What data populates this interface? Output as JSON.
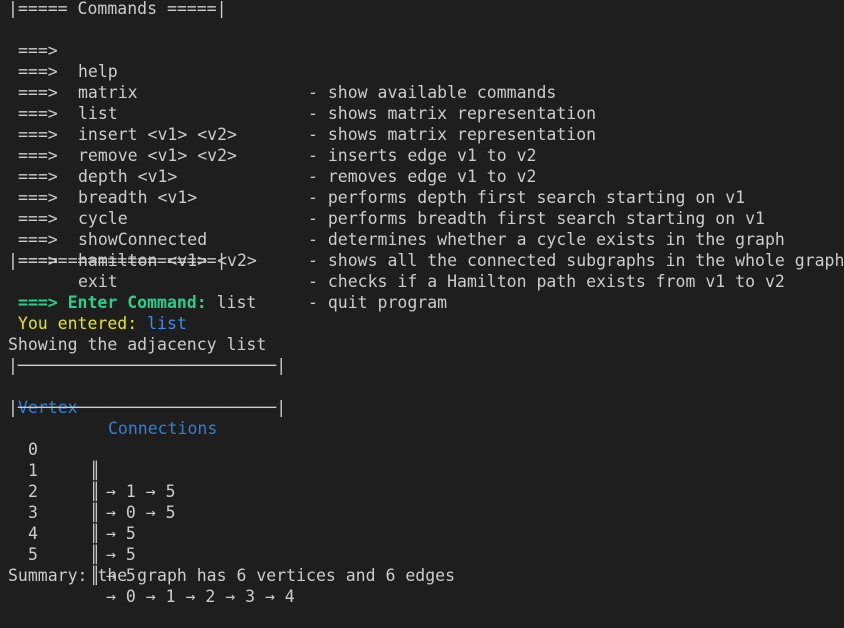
{
  "menu": {
    "top_border": "|===== Commands =====|",
    "bottom_border": "|====================|",
    "arrow": "===>",
    "commands": [
      {
        "name": "help",
        "desc": "- show available commands"
      },
      {
        "name": "matrix",
        "desc": "- shows matrix representation"
      },
      {
        "name": "list",
        "desc": "- shows matrix representation"
      },
      {
        "name": "insert <v1> <v2>",
        "desc": "- inserts edge v1 to v2"
      },
      {
        "name": "remove <v1> <v2>",
        "desc": "- removes edge v1 to v2"
      },
      {
        "name": "depth <v1>",
        "desc": "- performs depth first search starting on v1"
      },
      {
        "name": "breadth <v1>",
        "desc": "- performs breadth first search starting on v1"
      },
      {
        "name": "cycle",
        "desc": "- determines whether a cycle exists in the graph"
      },
      {
        "name": "showConnected",
        "desc": "- shows all the connected subgraphs in the whole graph"
      },
      {
        "name": "hamilton <v1> <v2>",
        "desc": "- checks if a Hamilton path exists from v1 to v2"
      },
      {
        "name": "exit",
        "desc": "- quit program"
      }
    ]
  },
  "prompt": {
    "label": " ===> Enter Command:",
    "input": " list"
  },
  "echo": {
    "label": " You entered:",
    "value": " list"
  },
  "adjacency": {
    "title": "Showing the adjacency list",
    "border": "|──────────────────────────|",
    "headers": {
      "vertex": "Vertex",
      "connections": "Connections"
    },
    "rows": [
      {
        "vertex": "0",
        "bar": "║",
        "connections": "→ 1 → 5"
      },
      {
        "vertex": "1",
        "bar": "║",
        "connections": "→ 0 → 5"
      },
      {
        "vertex": "2",
        "bar": "║",
        "connections": "→ 5"
      },
      {
        "vertex": "3",
        "bar": "║",
        "connections": "→ 5"
      },
      {
        "vertex": "4",
        "bar": "║",
        "connections": "→ 5"
      },
      {
        "vertex": "5",
        "bar": "║",
        "connections": "→ 0 → 1 → 2 → 3 → 4"
      }
    ]
  },
  "summary": "Summary: the graph has 6 vertices and 6 edges",
  "colors": {
    "background": "#1e1e1e",
    "text": "#cccccc",
    "prompt_green": "#23d18b",
    "echo_yellow": "#e5e510",
    "value_blue": "#3b8eea"
  }
}
